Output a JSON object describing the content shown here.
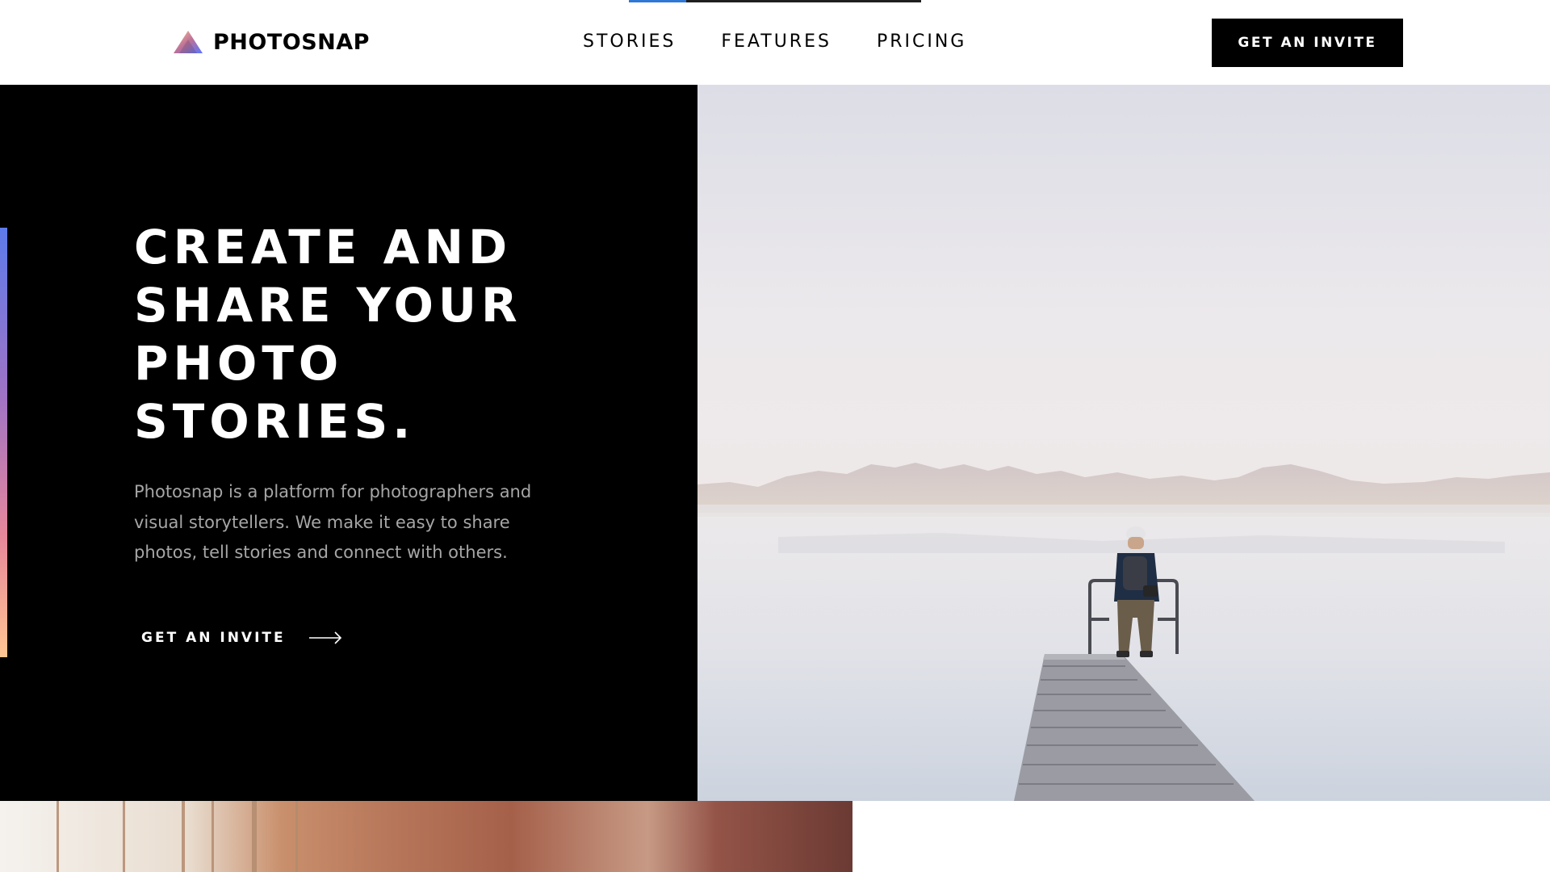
{
  "brand": {
    "name": "PHOTOSNAP",
    "logo_icon": "triangle-logo-icon"
  },
  "nav": {
    "items": [
      {
        "label": "STORIES"
      },
      {
        "label": "FEATURES"
      },
      {
        "label": "PRICING"
      }
    ]
  },
  "header": {
    "cta_label": "GET AN INVITE"
  },
  "hero": {
    "title_lines": [
      "CREATE AND",
      "SHARE YOUR",
      "PHOTO",
      "STORIES."
    ],
    "description": "Photosnap is a platform for photographers and visual storytellers. We make it easy to share photos, tell stories and connect with others.",
    "cta_label": "GET AN INVITE",
    "cta_icon": "arrow-right-icon",
    "image_subject": "person-on-pier-image"
  },
  "colors": {
    "background": "#ffffff",
    "hero_panel": "#000000",
    "text_primary": "#000000",
    "text_on_dark": "#ffffff",
    "text_muted": "#a6a6a6",
    "accent_gradient": [
      "#5d7bea",
      "#a173c4",
      "#e7879a",
      "#ffc593"
    ],
    "scrollbar_thumb": "#2f78d6"
  }
}
